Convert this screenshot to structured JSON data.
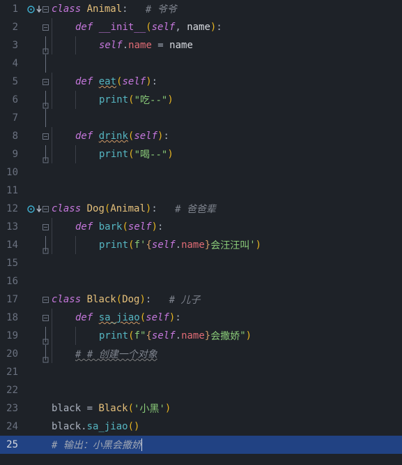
{
  "lines": {
    "1": {
      "num": "1"
    },
    "2": {
      "num": "2"
    },
    "3": {
      "num": "3"
    },
    "4": {
      "num": "4"
    },
    "5": {
      "num": "5"
    },
    "6": {
      "num": "6"
    },
    "7": {
      "num": "7"
    },
    "8": {
      "num": "8"
    },
    "9": {
      "num": "9"
    },
    "10": {
      "num": "10"
    },
    "11": {
      "num": "11"
    },
    "12": {
      "num": "12"
    },
    "13": {
      "num": "13"
    },
    "14": {
      "num": "14"
    },
    "15": {
      "num": "15"
    },
    "16": {
      "num": "16"
    },
    "17": {
      "num": "17"
    },
    "18": {
      "num": "18"
    },
    "19": {
      "num": "19"
    },
    "20": {
      "num": "20"
    },
    "21": {
      "num": "21"
    },
    "22": {
      "num": "22"
    },
    "23": {
      "num": "23"
    },
    "24": {
      "num": "24"
    },
    "25": {
      "num": "25"
    }
  },
  "tok": {
    "class": "class",
    "def": "def",
    "Animal": "Animal",
    "Dog": "Dog",
    "Black": "Black",
    "init": "__init__",
    "eat": "eat",
    "drink": "drink",
    "bark": "bark",
    "sa_jiao": "sa_jiao",
    "self": "self",
    "name": "name",
    "print": "print",
    "black": "black",
    "eq": " = ",
    "comma": ", ",
    "dot": ".",
    "colon": ":",
    "lpar": "(",
    "rpar": ")",
    "f": "f",
    "q1": "'",
    "q2": "\"",
    "lbr": "{",
    "rbr": "}",
    "sp": " ",
    "sp2": "  ",
    "sp3": "   "
  },
  "str": {
    "eat": "吃--",
    "drink": "喝--",
    "bark_suffix": "会汪汪叫",
    "sajiao_suffix": "会撒娇",
    "xiaohei": "小黑"
  },
  "comments": {
    "grandpa": "# 爷爷",
    "father": "# 爸爸辈",
    "son": "# 儿子",
    "create_obj": "# # 创建一个对象",
    "output": "# 输出：小黑会撒娇"
  }
}
